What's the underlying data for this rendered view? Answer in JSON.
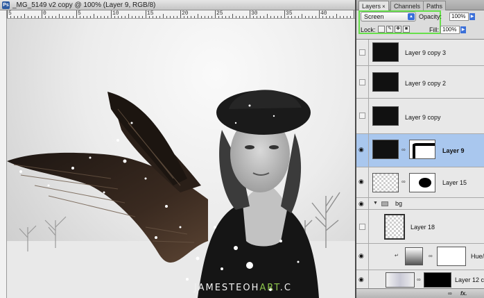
{
  "document": {
    "title": "_MG_5149 v2 copy @ 100% (Layer 9, RGB/8)",
    "ruler_labels": [
      "5",
      "0",
      "5",
      "10",
      "15",
      "20",
      "25",
      "30",
      "35",
      "40"
    ],
    "watermark_prefix": "JAMESTEOH",
    "watermark_accent": "ART",
    "watermark_suffix": ".C"
  },
  "panel": {
    "tabs": [
      {
        "label": "Layers",
        "active": true,
        "close": "×"
      },
      {
        "label": "Channels",
        "active": false
      },
      {
        "label": "Paths",
        "active": false
      }
    ],
    "blend_mode": "Screen",
    "opacity_label": "Opacity:",
    "opacity_value": "100%",
    "lock_label": "Lock:",
    "fill_label": "Fill:",
    "fill_value": "100%",
    "highlight_color": "#66e04a"
  },
  "layers": [
    {
      "name": "Layer 9 copy 3",
      "visible": false,
      "thumb": "snow",
      "selected": false
    },
    {
      "name": "Layer 9 copy 2",
      "visible": false,
      "thumb": "snow",
      "selected": false
    },
    {
      "name": "Layer 9 copy",
      "visible": false,
      "thumb": "snow",
      "selected": false
    },
    {
      "name": "Layer 9",
      "visible": true,
      "thumb": "snow",
      "mask": "mask-white",
      "selected": true
    },
    {
      "name": "Layer 15",
      "visible": true,
      "thumb": "checker",
      "mask": "mask-white",
      "selected": false
    },
    {
      "name": "bg",
      "visible": true,
      "group": true
    },
    {
      "name": "Layer 18",
      "visible": false,
      "thumb": "checker",
      "selected": false
    },
    {
      "name": "Hue/S",
      "visible": true,
      "thumb": "adj",
      "mask": "mask-white",
      "selected": false
    },
    {
      "name": "Layer 12 c",
      "visible": true,
      "thumb": "cloudy",
      "mask": "black",
      "selected": false
    }
  ],
  "bottom_icons": [
    "link-icon",
    "fx-icon"
  ],
  "bottom_text": {
    "fx": "fx."
  }
}
